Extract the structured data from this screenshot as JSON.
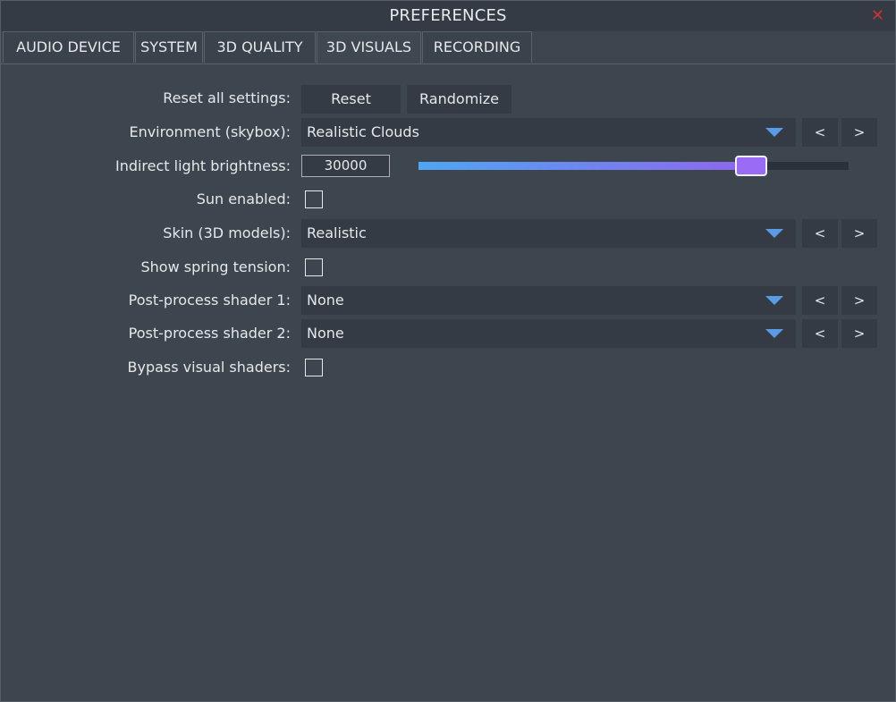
{
  "window": {
    "title": "PREFERENCES"
  },
  "tabs": [
    {
      "label": "AUDIO DEVICE"
    },
    {
      "label": "SYSTEM"
    },
    {
      "label": "3D QUALITY"
    },
    {
      "label": "3D VISUALS",
      "active": true
    },
    {
      "label": "RECORDING"
    }
  ],
  "settings": {
    "reset": {
      "label": "Reset all settings:",
      "reset_button": "Reset",
      "randomize_button": "Randomize"
    },
    "environment": {
      "label": "Environment (skybox):",
      "value": "Realistic Clouds"
    },
    "indirect_light": {
      "label": "Indirect light brightness:",
      "value": "30000",
      "slider_fraction": 0.77
    },
    "sun": {
      "label": "Sun enabled:",
      "checked": false
    },
    "skin": {
      "label": "Skin (3D models):",
      "value": "Realistic"
    },
    "spring": {
      "label": "Show spring tension:",
      "checked": false
    },
    "shader1": {
      "label": "Post-process shader 1:",
      "value": "None"
    },
    "shader2": {
      "label": "Post-process shader 2:",
      "value": "None"
    },
    "bypass": {
      "label": "Bypass visual shaders:",
      "checked": false
    }
  },
  "nav": {
    "prev": "<",
    "next": ">"
  },
  "icons": {
    "close": "close-icon",
    "dropdown": "chevron-down-icon"
  },
  "colors": {
    "accent": "#5a9be6",
    "slider_start": "#4fa6f2",
    "slider_end": "#8e66ee",
    "close": "#cc3333"
  }
}
